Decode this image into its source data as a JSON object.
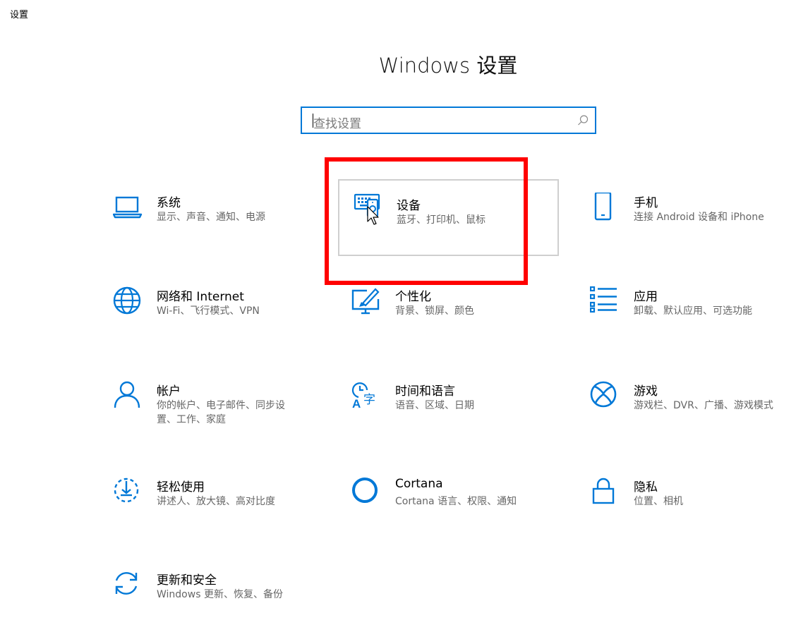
{
  "window": {
    "title": "设置"
  },
  "header": {
    "title": "Windows 设置"
  },
  "search": {
    "placeholder": "查找设置"
  },
  "categories": [
    {
      "name": "系统",
      "desc": "显示、声音、通知、电源",
      "icon": "laptop-icon"
    },
    {
      "name": "设备",
      "desc": "蓝牙、打印机、鼠标",
      "icon": "devices-icon"
    },
    {
      "name": "手机",
      "desc": "连接 Android 设备和 iPhone",
      "icon": "phone-icon"
    },
    {
      "name": "网络和 Internet",
      "desc": "Wi-Fi、飞行模式、VPN",
      "icon": "globe-icon"
    },
    {
      "name": "个性化",
      "desc": "背景、锁屏、颜色",
      "icon": "personalization-icon"
    },
    {
      "name": "应用",
      "desc": "卸载、默认应用、可选功能",
      "icon": "apps-list-icon"
    },
    {
      "name": "帐户",
      "desc": "你的帐户、电子邮件、同步设置、工作、家庭",
      "icon": "person-icon"
    },
    {
      "name": "时间和语言",
      "desc": "语音、区域、日期",
      "icon": "time-language-icon"
    },
    {
      "name": "游戏",
      "desc": "游戏栏、DVR、广播、游戏模式",
      "icon": "xbox-icon"
    },
    {
      "name": "轻松使用",
      "desc": "讲述人、放大镜、高对比度",
      "icon": "ease-of-access-icon"
    },
    {
      "name": "Cortana",
      "desc": "Cortana 语言、权限、通知",
      "icon": "cortana-icon"
    },
    {
      "name": "隐私",
      "desc": "位置、相机",
      "icon": "lock-icon"
    },
    {
      "name": "更新和安全",
      "desc": "Windows 更新、恢复、备份",
      "icon": "update-icon"
    }
  ],
  "colors": {
    "accent": "#0078d7",
    "highlight": "#ff0000"
  }
}
